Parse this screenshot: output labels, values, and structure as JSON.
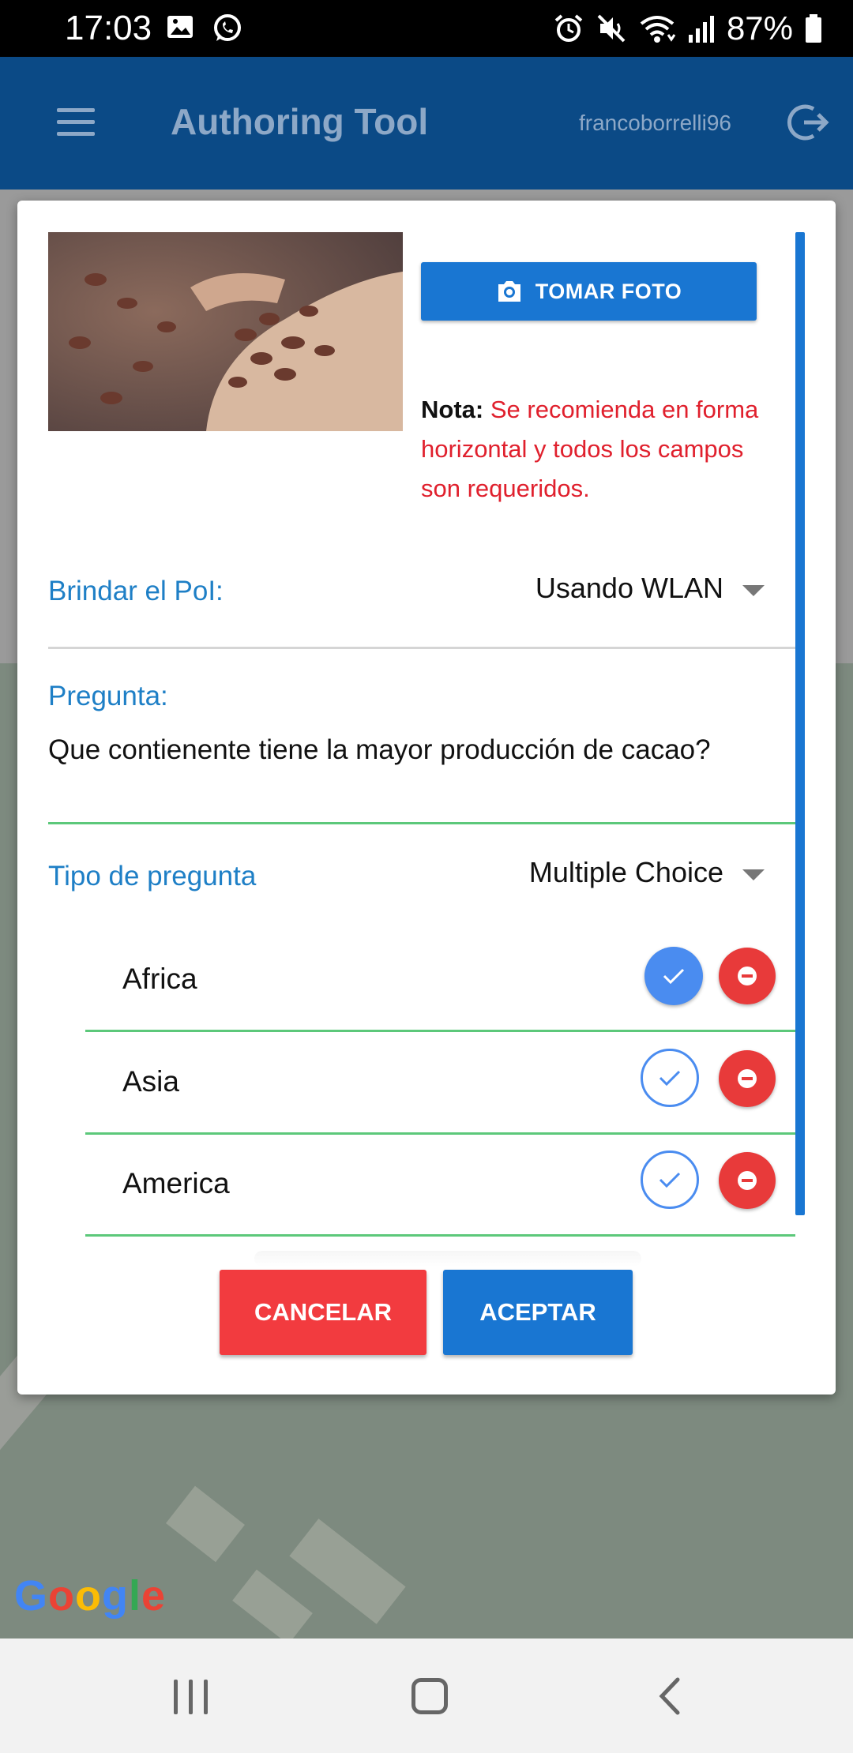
{
  "status_bar": {
    "time": "17:03",
    "battery": "87%",
    "icons": [
      "gallery-icon",
      "whatsapp-icon",
      "alarm-icon",
      "mute-icon",
      "wifi-icon",
      "signal-icon",
      "battery-icon"
    ]
  },
  "app_bar": {
    "title": "Authoring Tool",
    "username": "francoborrelli96",
    "icons": [
      "menu-icon",
      "logout-icon"
    ]
  },
  "dialog": {
    "photo_button_label": "TOMAR FOTO",
    "note_label": "Nota:",
    "note_text": "Se recomienda en forma horizontal y todos los campos son requeridos.",
    "poi_label": "Brindar el PoI:",
    "poi_value": "Usando WLAN",
    "question_label": "Pregunta:",
    "question_text": "Que contienente tiene la mayor producción de cacao?",
    "type_label": "Tipo de pregunta",
    "type_value": "Multiple Choice",
    "answers": [
      {
        "label": "Africa",
        "correct": true
      },
      {
        "label": "Asia",
        "correct": false
      },
      {
        "label": "America",
        "correct": false
      }
    ],
    "cancel_label": "CANCELAR",
    "accept_label": "ACEPTAR"
  },
  "map": {
    "attribution": "Google"
  },
  "colors": {
    "app_bar": "#0b4a86",
    "accent_blue": "#1976d2",
    "label_blue": "#1e7fc6",
    "danger_red": "#f23b3f",
    "note_red": "#e0202d",
    "success_green": "#5cc87a"
  }
}
